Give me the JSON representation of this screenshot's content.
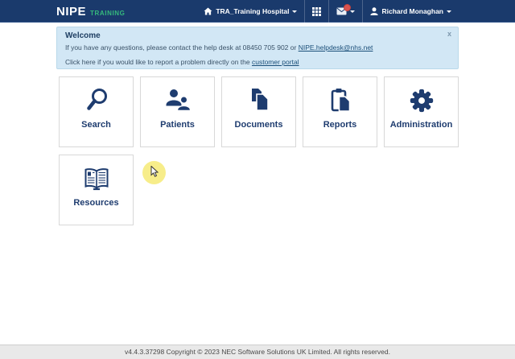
{
  "navbar": {
    "brand": "NIPE",
    "brand_suffix": "TRAINING",
    "hospital_label": "TRA_Training Hospital",
    "user_label": "Richard Monaghan"
  },
  "alert": {
    "title": "Welcome",
    "line1_text": "If you have any questions, please contact the help desk at 08450 705 902 or ",
    "line1_link": "NIPE.helpdesk@nhs.net",
    "line2_text": "Click here if you would like to report a problem directly on the ",
    "line2_link": "customer portal",
    "close_glyph": "x"
  },
  "tiles": [
    {
      "label": "Search",
      "icon": "search-icon"
    },
    {
      "label": "Patients",
      "icon": "patients-icon"
    },
    {
      "label": "Documents",
      "icon": "documents-icon"
    },
    {
      "label": "Reports",
      "icon": "reports-icon"
    },
    {
      "label": "Administration",
      "icon": "administration-icon"
    },
    {
      "label": "Resources",
      "icon": "resources-icon"
    }
  ],
  "footer": {
    "text": "v4.4.3.37298 Copyright © 2023 NEC Software Solutions UK Limited. All rights reserved."
  },
  "colors": {
    "navbar_bg": "#1a3a6c",
    "brand_green": "#35b97c",
    "tile_navy": "#1e3c6f",
    "alert_bg": "#d2e7f5",
    "badge_red": "#d9534f",
    "highlight_yellow": "#f6ea75"
  }
}
